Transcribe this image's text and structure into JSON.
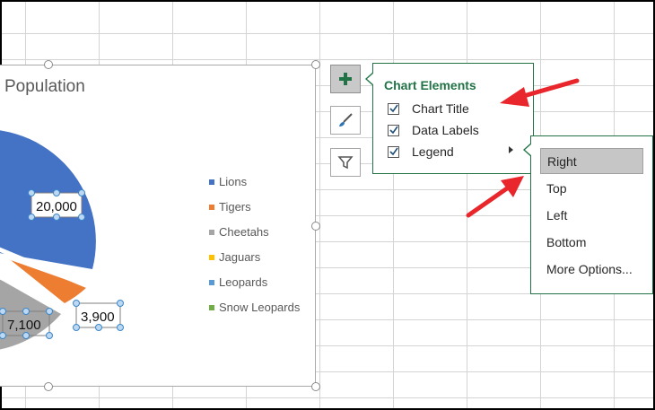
{
  "chart": {
    "title": "Population",
    "data_labels": [
      "20,000",
      "7,100",
      "3,900"
    ],
    "legend": [
      {
        "label": "Lions",
        "color": "#4472c4"
      },
      {
        "label": "Tigers",
        "color": "#ed7d31"
      },
      {
        "label": "Cheetahs",
        "color": "#a5a5a5"
      },
      {
        "label": "Jaguars",
        "color": "#ffc000"
      },
      {
        "label": "Leopards",
        "color": "#5b9bd5"
      },
      {
        "label": "Snow Leopards",
        "color": "#70ad47"
      }
    ]
  },
  "side_buttons": {
    "elements_icon": "plus-icon",
    "styles_icon": "paintbrush-icon",
    "filters_icon": "funnel-icon"
  },
  "elements_panel": {
    "title": "Chart Elements",
    "items": [
      {
        "label": "Chart Title",
        "checked": true
      },
      {
        "label": "Data Labels",
        "checked": true
      },
      {
        "label": "Legend",
        "checked": true
      }
    ]
  },
  "legend_submenu": {
    "selected": "Right",
    "items": [
      "Right",
      "Top",
      "Left",
      "Bottom",
      "More Options..."
    ]
  },
  "colors": {
    "accent_green": "#217346",
    "annotation_red": "#e8262b"
  }
}
